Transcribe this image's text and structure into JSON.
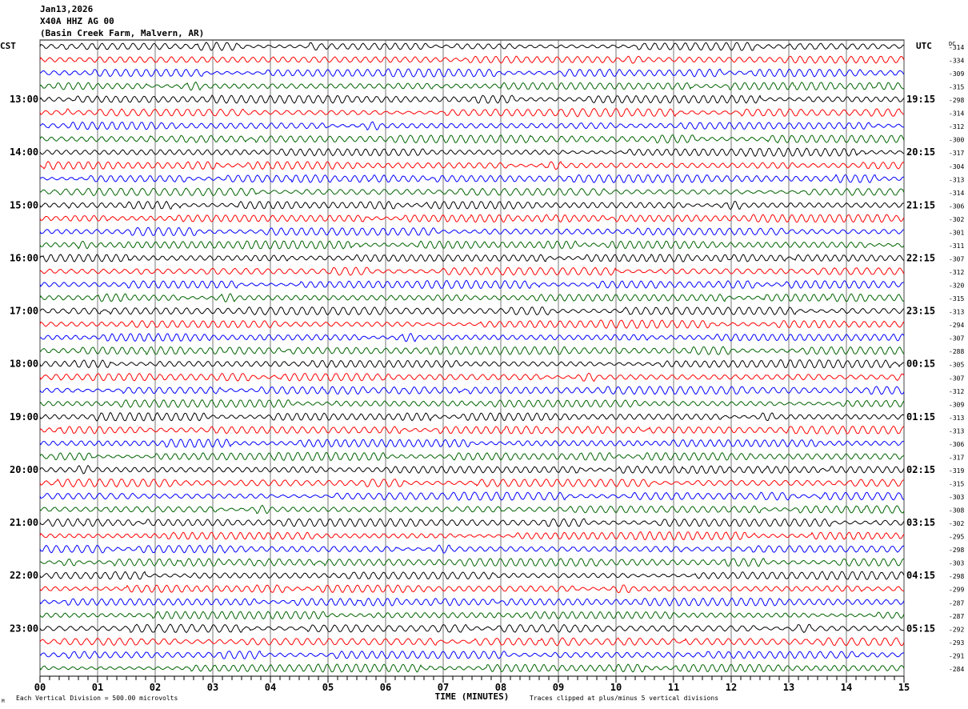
{
  "header": {
    "date": "Jan13,2026",
    "station": "X40A HHZ AG 00",
    "location": "(Basin Creek Farm, Malvern, AR)"
  },
  "chart_data": {
    "type": "line",
    "subtype": "helicorder",
    "xlabel": "TIME (MINUTES)",
    "x_ticks": [
      "00",
      "01",
      "02",
      "03",
      "04",
      "05",
      "06",
      "07",
      "08",
      "09",
      "10",
      "11",
      "12",
      "13",
      "14",
      "15"
    ],
    "xlim": [
      0,
      15
    ],
    "left_axis_title": "CST",
    "right_axis_title": "UTC",
    "dc_title": "DC",
    "cst_labels": [
      "13:00",
      "14:00",
      "15:00",
      "16:00",
      "17:00",
      "18:00",
      "19:00",
      "20:00",
      "21:00",
      "22:00",
      "23:00"
    ],
    "utc_labels": [
      "19:15",
      "20:15",
      "21:15",
      "22:15",
      "23:15",
      "00:15",
      "01:15",
      "02:15",
      "03:15",
      "04:15",
      "05:15"
    ],
    "dc_offsets": [
      -314,
      -334,
      -309,
      -315,
      -298,
      -314,
      -312,
      -300,
      -317,
      -304,
      -313,
      -314,
      -306,
      -302,
      -301,
      -311,
      -307,
      -312,
      -320,
      -315,
      -313,
      -294,
      -307,
      -288,
      -305,
      -307,
      -312,
      -309,
      -313,
      -313,
      -306,
      -317,
      -319,
      -315,
      -303,
      -308,
      -302,
      -295,
      -298,
      -303,
      -298,
      -299,
      -287,
      -287,
      -292,
      -293,
      -291,
      -284
    ],
    "trace_colors": [
      "#000000",
      "#ff0000",
      "#0000ff",
      "#006400"
    ],
    "scale_note": "Each Vertical Division =  500.00 microvolts",
    "clip_note": "Traces clipped at plus/minus 5 vertical divisions",
    "corner_mark": "M"
  }
}
